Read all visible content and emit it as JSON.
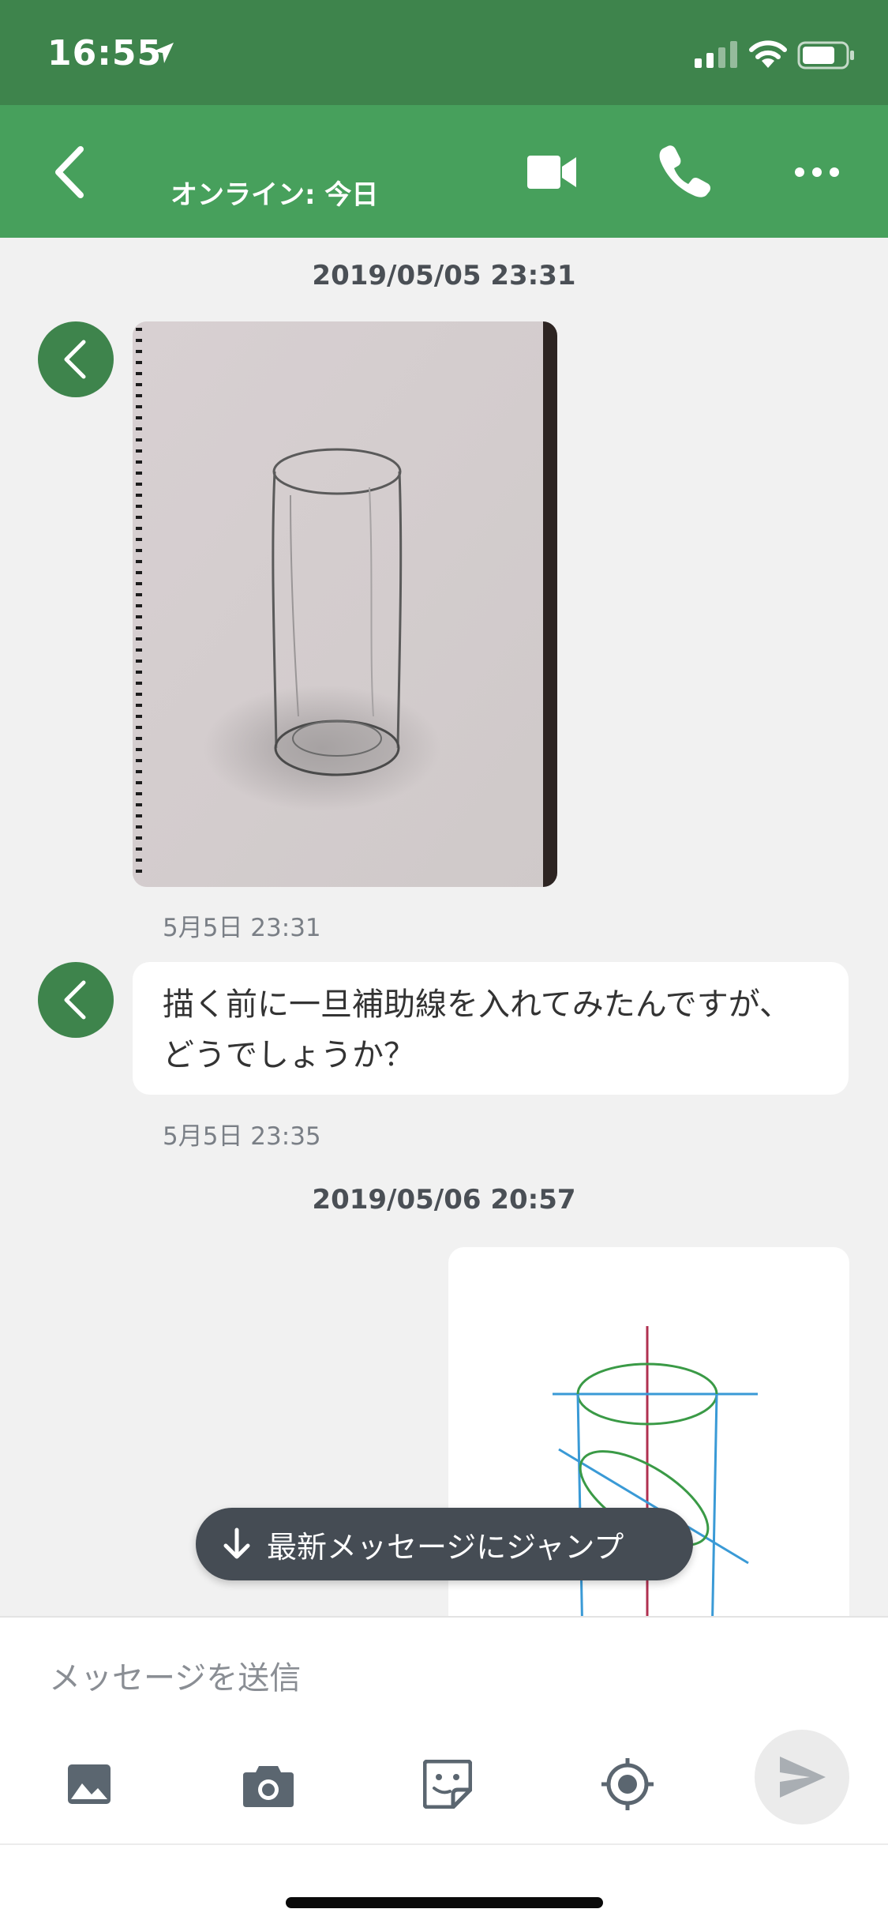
{
  "status_bar": {
    "time": "16:55",
    "icons": [
      "location-arrow-icon",
      "signal-icon",
      "wifi-icon",
      "battery-icon"
    ]
  },
  "header": {
    "online_status": "オンライン: 今日",
    "icons": [
      "back-icon",
      "video-call-icon",
      "phone-icon",
      "more-icon"
    ],
    "color": "#47a05c"
  },
  "chat": {
    "date_1": "2019/05/05 23:31",
    "msg_1_time": "5月5日 23:31",
    "msg_2_text_line1": "描く前に一旦補助線を入れてみたんですが、",
    "msg_2_text_line2": "どうでしょうか？",
    "msg_2_time": "5月5日 23:35",
    "date_2": "2019/05/06 20:57",
    "jump_label": "最新メッセージにジャンプ"
  },
  "composer": {
    "placeholder": "メッセージを送信",
    "tools": [
      "image-icon",
      "camera-icon",
      "sticker-icon",
      "location-icon"
    ],
    "send_icon": "send-icon"
  },
  "colors": {
    "status_bar": "#3e844c",
    "header": "#47a05c",
    "avatar": "#3e844c",
    "background": "#f1f1f1"
  }
}
